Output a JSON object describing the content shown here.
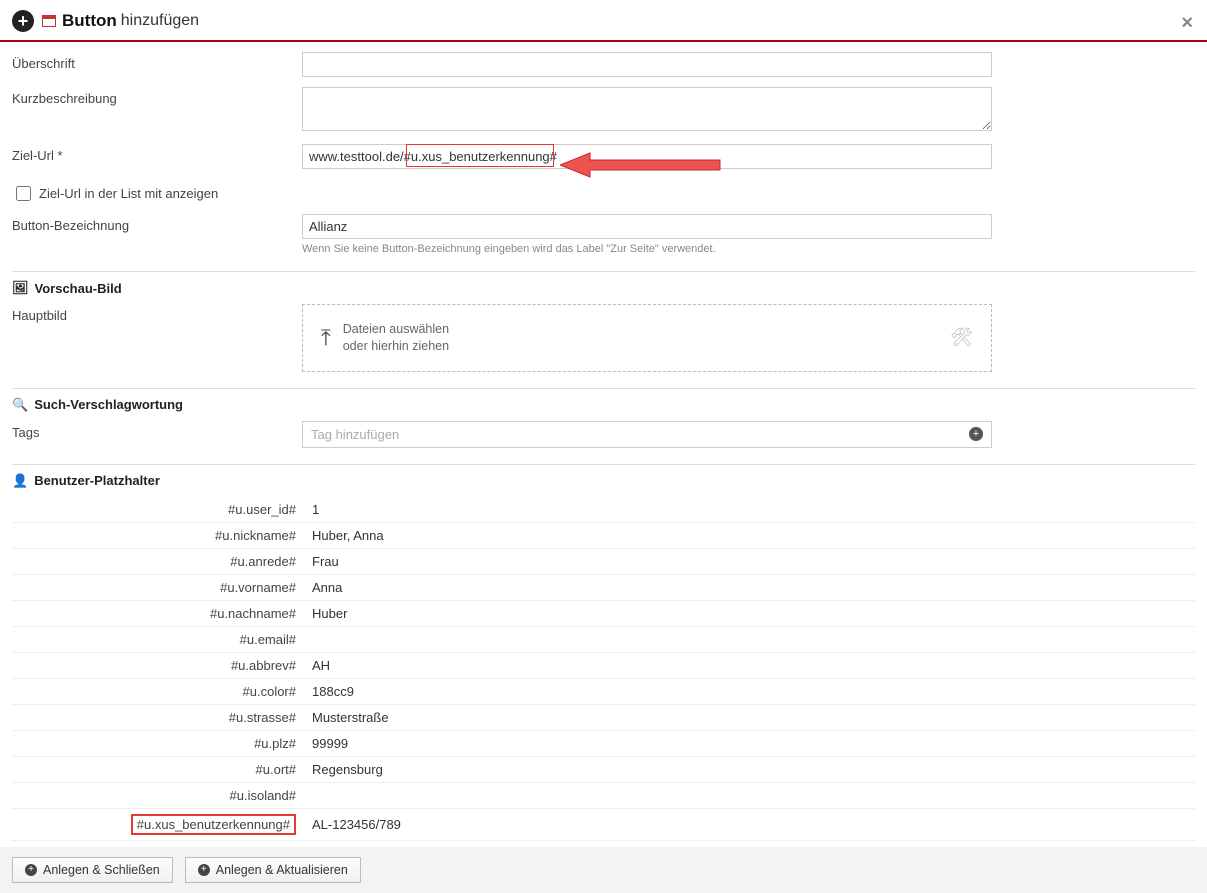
{
  "header": {
    "title_bold": "Button",
    "title_light": "hinzufügen"
  },
  "form": {
    "ueberschrift_label": "Überschrift",
    "ueberschrift_value": "",
    "kurz_label": "Kurzbeschreibung",
    "kurz_value": "",
    "zielurl_label": "Ziel-Url *",
    "zielurl_value": "www.testtool.de/#u.xus_benutzerkennung#",
    "zielurl_list_label": "Ziel-Url in der List mit anzeigen",
    "buttonbez_label": "Button-Bezeichnung",
    "buttonbez_value": "Allianz",
    "buttonbez_hint": "Wenn Sie keine Button-Bezeichnung eingeben wird das Label \"Zur Seite\" verwendet."
  },
  "sections": {
    "vorschau_title": "Vorschau-Bild",
    "hauptbild_label": "Hauptbild",
    "upload_line1": "Dateien auswählen",
    "upload_line2": "oder hierhin ziehen",
    "such_title": "Such-Verschlagwortung",
    "tags_label": "Tags",
    "tags_placeholder": "Tag hinzufügen",
    "platzhalter_title": "Benutzer-Platzhalter"
  },
  "placeholders": [
    {
      "key": "#u.user_id#",
      "val": "1"
    },
    {
      "key": "#u.nickname#",
      "val": "Huber, Anna"
    },
    {
      "key": "#u.anrede#",
      "val": "Frau"
    },
    {
      "key": "#u.vorname#",
      "val": "Anna"
    },
    {
      "key": "#u.nachname#",
      "val": "Huber"
    },
    {
      "key": "#u.email#",
      "val": ""
    },
    {
      "key": "#u.abbrev#",
      "val": "AH"
    },
    {
      "key": "#u.color#",
      "val": "188cc9"
    },
    {
      "key": "#u.strasse#",
      "val": "Musterstraße"
    },
    {
      "key": "#u.plz#",
      "val": "99999"
    },
    {
      "key": "#u.ort#",
      "val": "Regensburg"
    },
    {
      "key": "#u.isoland#",
      "val": ""
    },
    {
      "key": "#u.xus_benutzerkennung#",
      "val": "AL-123456/789",
      "highlight": true
    }
  ],
  "footer": {
    "btn_close": "Anlegen & Schließen",
    "btn_update": "Anlegen & Aktualisieren"
  }
}
